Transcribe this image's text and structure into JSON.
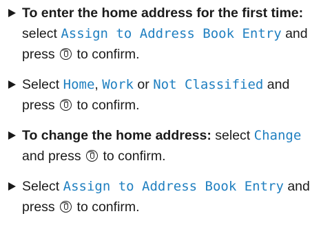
{
  "steps": [
    {
      "lead": "To enter the home address for the first time:",
      "before": " select ",
      "option": "Assign to Address Book Entry",
      "after_option": " and press ",
      "end": " to confirm."
    },
    {
      "before": "Select ",
      "option1": "Home",
      "sep1": ", ",
      "option2": "Work",
      "sep2": " or ",
      "option3": "Not Classified",
      "after_option": " and press ",
      "end": " to confirm."
    },
    {
      "lead": "To change the home address:",
      "before": " select ",
      "option": "Change",
      "after_option": " and press ",
      "end": " to confirm."
    },
    {
      "before": "Select ",
      "option": "Assign to Address Book Entry",
      "after_option": " and press ",
      "end": " to confirm."
    }
  ],
  "icons": {
    "bullet": "triangle-right-icon",
    "confirm": "controller-press-icon"
  }
}
